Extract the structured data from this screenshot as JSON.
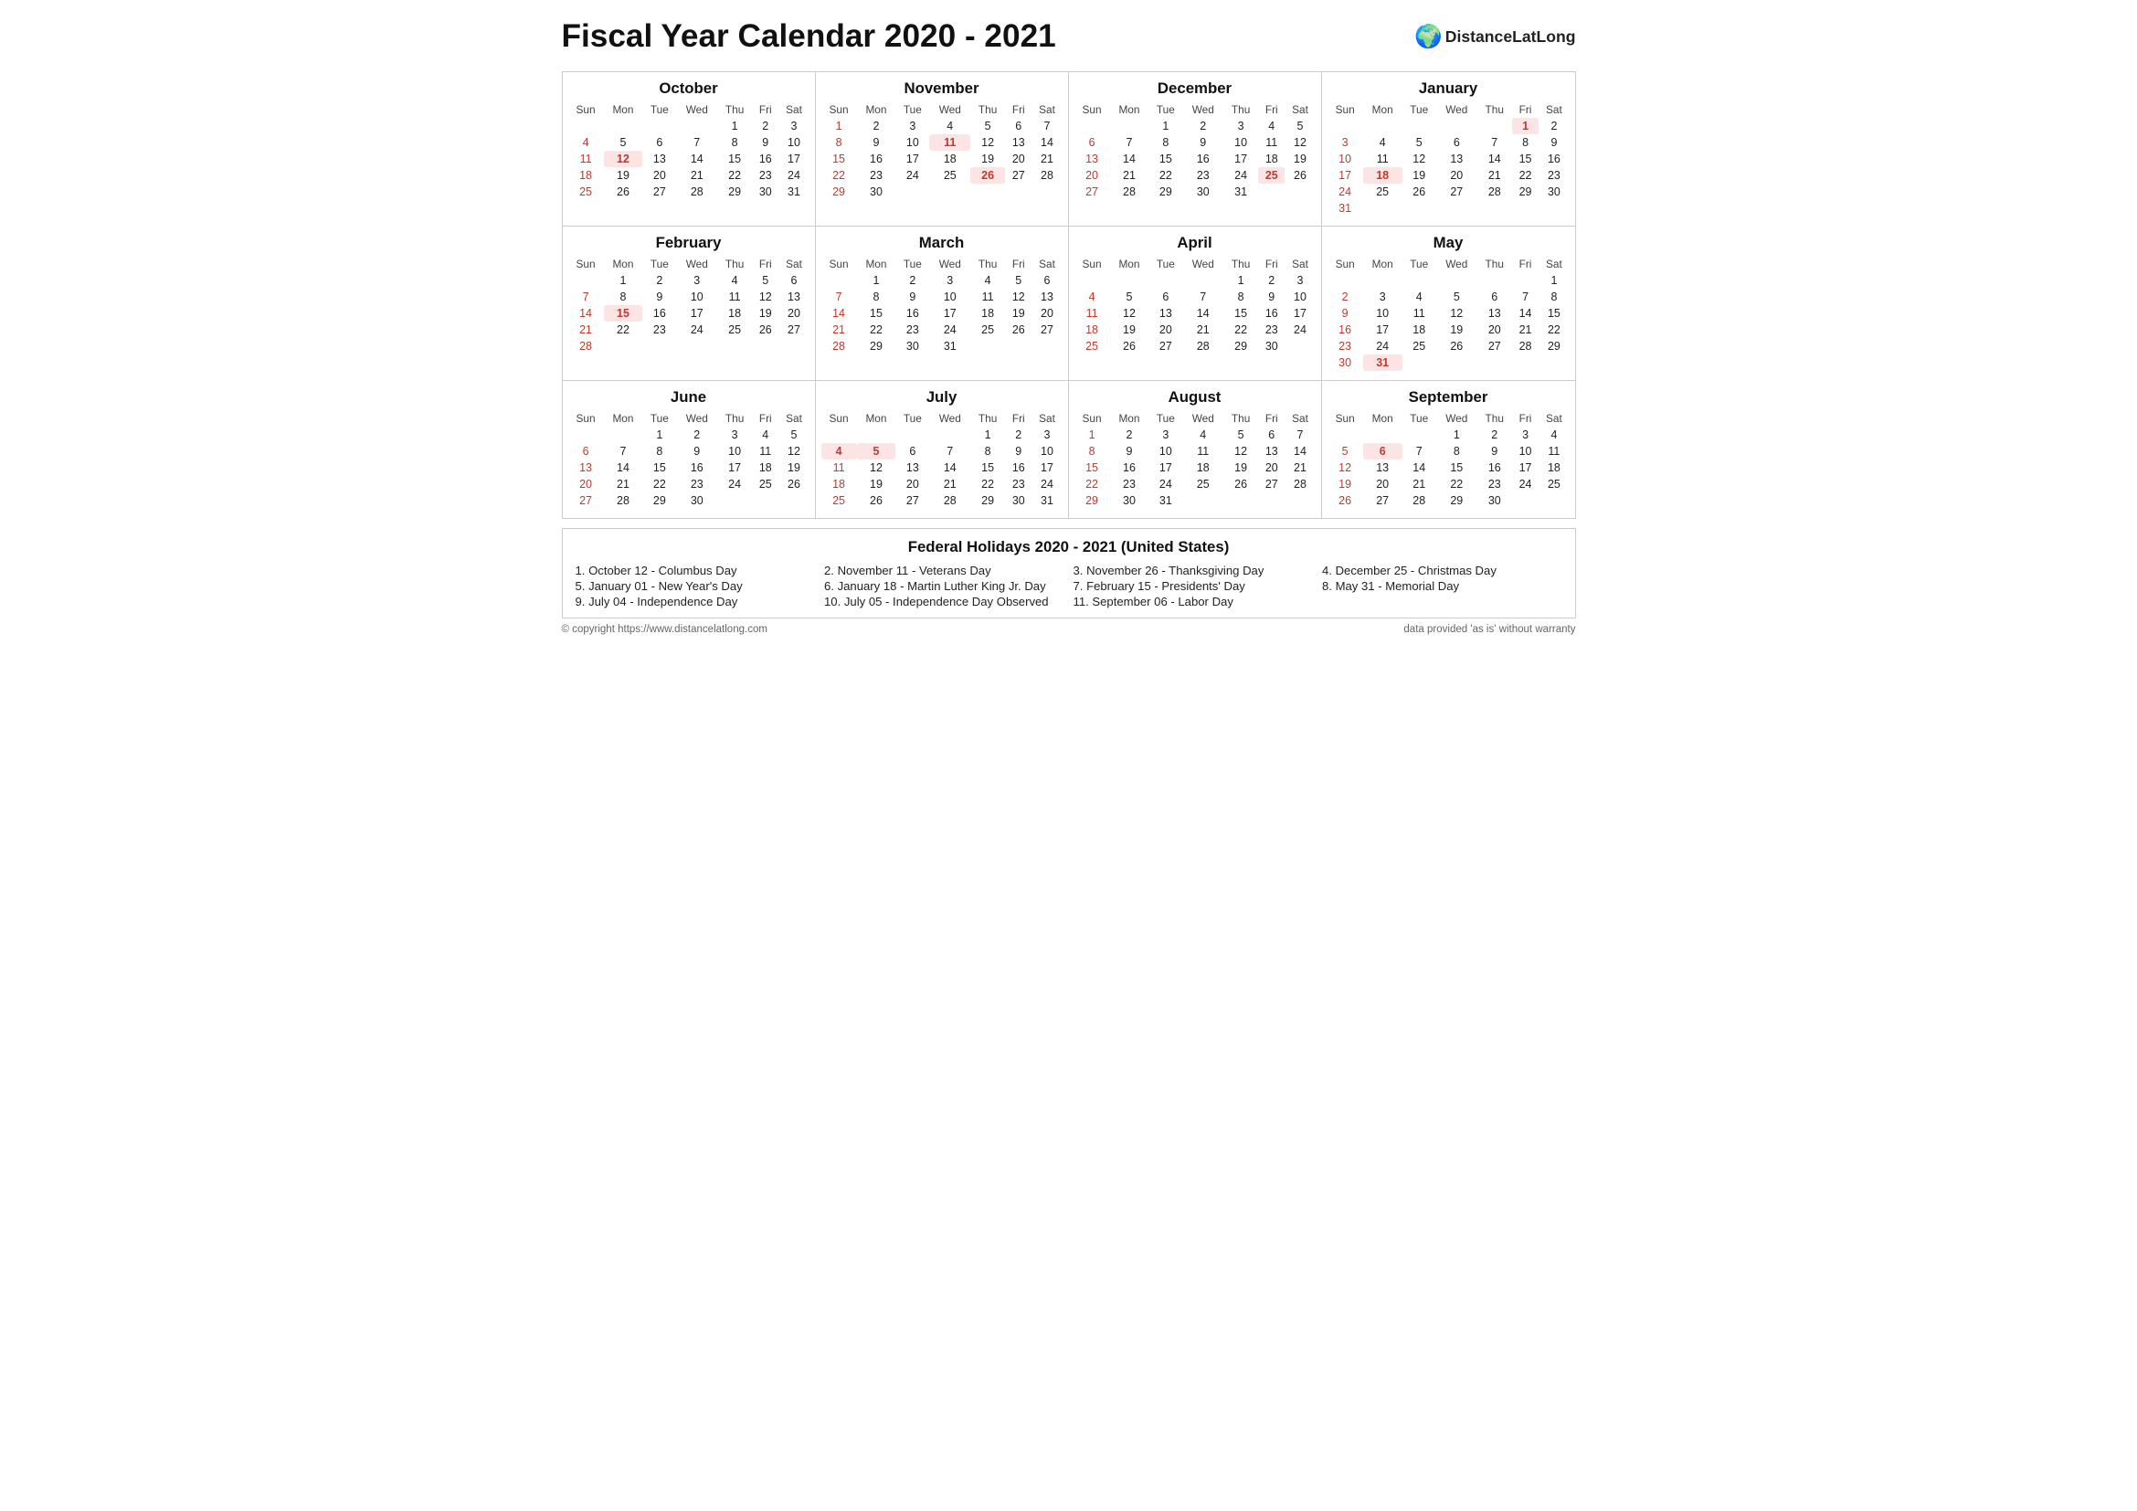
{
  "title": "Fiscal Year Calendar 2020 - 2021",
  "logo": {
    "text": "DistanceLatLong",
    "icon": "🌍"
  },
  "months": [
    {
      "name": "October",
      "year": 2020,
      "startDay": 4,
      "days": 31,
      "holidays": [
        12
      ],
      "sundays": [
        4,
        11,
        18,
        25
      ],
      "saturdays": [
        3,
        10,
        17,
        24,
        31
      ]
    },
    {
      "name": "November",
      "year": 2020,
      "startDay": 0,
      "days": 30,
      "holidays": [
        11,
        26
      ],
      "sundays": [
        1,
        8,
        15,
        22,
        29
      ],
      "saturdays": [
        7,
        14,
        21,
        28
      ]
    },
    {
      "name": "December",
      "year": 2020,
      "startDay": 2,
      "days": 31,
      "holidays": [
        25
      ],
      "sundays": [
        6,
        13,
        20,
        27
      ],
      "saturdays": [
        5,
        12,
        19,
        26
      ]
    },
    {
      "name": "January",
      "year": 2021,
      "startDay": 5,
      "days": 31,
      "holidays": [
        1,
        18
      ],
      "sundays": [
        3,
        10,
        17,
        24,
        31
      ],
      "saturdays": [
        2,
        9,
        16,
        23,
        30
      ]
    },
    {
      "name": "February",
      "year": 2021,
      "startDay": 1,
      "days": 28,
      "holidays": [
        15
      ],
      "sundays": [
        7,
        14,
        21,
        28
      ],
      "saturdays": [
        6,
        13,
        20,
        27
      ]
    },
    {
      "name": "March",
      "year": 2021,
      "startDay": 1,
      "days": 31,
      "holidays": [],
      "sundays": [
        7,
        14,
        21,
        28
      ],
      "saturdays": [
        6,
        13,
        20,
        27
      ]
    },
    {
      "name": "April",
      "year": 2021,
      "startDay": 4,
      "days": 30,
      "holidays": [],
      "sundays": [
        4,
        11,
        18,
        25
      ],
      "saturdays": [
        3,
        10,
        17,
        24
      ]
    },
    {
      "name": "May",
      "year": 2021,
      "startDay": 6,
      "days": 31,
      "holidays": [
        31
      ],
      "sundays": [
        2,
        9,
        16,
        23,
        30
      ],
      "saturdays": [
        1,
        8,
        15,
        22,
        29
      ]
    },
    {
      "name": "June",
      "year": 2021,
      "startDay": 2,
      "days": 30,
      "holidays": [],
      "sundays": [
        6,
        13,
        20,
        27
      ],
      "saturdays": [
        5,
        12,
        19,
        26
      ]
    },
    {
      "name": "July",
      "year": 2021,
      "startDay": 4,
      "days": 31,
      "holidays": [
        4,
        5
      ],
      "sundays": [
        4,
        11,
        18,
        25
      ],
      "saturdays": [
        3,
        10,
        17,
        24,
        31
      ]
    },
    {
      "name": "August",
      "year": 2021,
      "startDay": 0,
      "days": 31,
      "holidays": [],
      "sundays": [
        1,
        8,
        15,
        22,
        29
      ],
      "saturdays": [
        7,
        14,
        21,
        28
      ]
    },
    {
      "name": "September",
      "year": 2021,
      "startDay": 3,
      "days": 30,
      "holidays": [
        6
      ],
      "sundays": [
        5,
        12,
        19,
        26
      ],
      "saturdays": [
        4,
        11,
        18,
        25
      ]
    }
  ],
  "holidays_section": {
    "title": "Federal Holidays 2020 - 2021 (United States)",
    "items": [
      "1. October 12 - Columbus Day",
      "2. November 11 - Veterans Day",
      "3. November 26 - Thanksgiving Day",
      "4. December 25 - Christmas Day",
      "5. January 01 - New Year's Day",
      "6. January 18 - Martin Luther King Jr. Day",
      "7. February 15 - Presidents' Day",
      "8. May 31 - Memorial Day",
      "9. July 04 - Independence Day",
      "10. July 05 - Independence Day Observed",
      "11. September 06 - Labor Day",
      ""
    ]
  },
  "footer": {
    "left": "© copyright https://www.distancelatlong.com",
    "right": "data provided 'as is' without warranty"
  }
}
